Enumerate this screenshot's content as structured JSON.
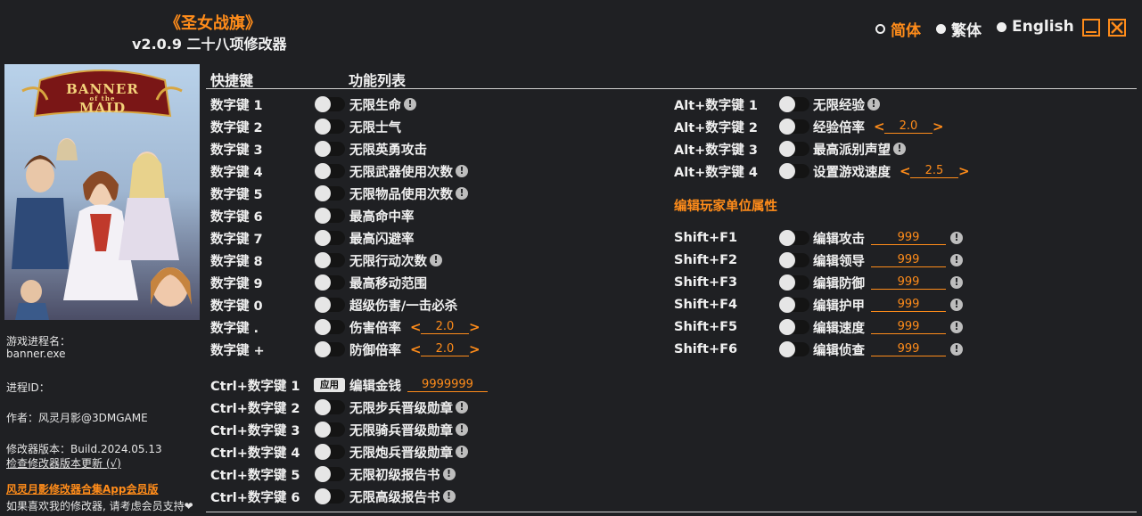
{
  "title": {
    "game": "《圣女战旗》",
    "trainer": "v2.0.9 二十八项修改器"
  },
  "languages": [
    {
      "label": "简体",
      "active": true
    },
    {
      "label": "繁体",
      "active": false
    },
    {
      "label": "English",
      "active": false
    }
  ],
  "banner": {
    "logo_line1": "BANNER",
    "logo_of": "of the",
    "logo_line2": "MAID"
  },
  "sidebar": {
    "process_name_label": "游戏进程名：",
    "process_name": "banner.exe",
    "process_id_label": "进程ID：",
    "author": "作者：风灵月影@3DMGAME",
    "version": "修改器版本：Build.2024.05.13",
    "check_update": "检查修改器版本更新 (√)",
    "app_link": "风灵月影修改器合集App会员版",
    "support": "如果喜欢我的修改器, 请考虑会员支持❤"
  },
  "headers": {
    "hotkey": "快捷键",
    "features": "功能列表"
  },
  "info_glyph": "!",
  "left_rows": [
    {
      "key": "数字键 1",
      "label": "无限生命",
      "info": true
    },
    {
      "key": "数字键 2",
      "label": "无限士气",
      "info": false
    },
    {
      "key": "数字键 3",
      "label": "无限英勇攻击",
      "info": false
    },
    {
      "key": "数字键 4",
      "label": "无限武器使用次数",
      "info": true
    },
    {
      "key": "数字键 5",
      "label": "无限物品使用次数",
      "info": true
    },
    {
      "key": "数字键 6",
      "label": "最高命中率",
      "info": false
    },
    {
      "key": "数字键 7",
      "label": "最高闪避率",
      "info": false
    },
    {
      "key": "数字键 8",
      "label": "无限行动次数",
      "info": true
    },
    {
      "key": "数字键 9",
      "label": "最高移动范围",
      "info": false
    },
    {
      "key": "数字键 0",
      "label": "超级伤害/一击必杀",
      "info": false
    },
    {
      "key": "数字键 .",
      "label": "伤害倍率",
      "value": "2.0"
    },
    {
      "key": "数字键 +",
      "label": "防御倍率",
      "value": "2.0"
    }
  ],
  "arrows": {
    "left": "<",
    "right": ">"
  },
  "ctrl_rows": [
    {
      "key": "Ctrl+数字键 1",
      "label": "编辑金钱",
      "apply": "应用",
      "value": "9999999"
    },
    {
      "key": "Ctrl+数字键 2",
      "label": "无限步兵晋级勋章",
      "info": true
    },
    {
      "key": "Ctrl+数字键 3",
      "label": "无限骑兵晋级勋章",
      "info": true
    },
    {
      "key": "Ctrl+数字键 4",
      "label": "无限炮兵晋级勋章",
      "info": true
    },
    {
      "key": "Ctrl+数字键 5",
      "label": "无限初级报告书",
      "info": true
    },
    {
      "key": "Ctrl+数字键 6",
      "label": "无限高级报告书",
      "info": true
    }
  ],
  "alt_rows": [
    {
      "key": "Alt+数字键 1",
      "label": "无限经验",
      "info": true
    },
    {
      "key": "Alt+数字键 2",
      "label": "经验倍率",
      "value": "2.0"
    },
    {
      "key": "Alt+数字键 3",
      "label": "最高派别声望",
      "info": true
    },
    {
      "key": "Alt+数字键 4",
      "label": "设置游戏速度",
      "value": "2.5"
    }
  ],
  "section_title": "编辑玩家单位属性",
  "shift_rows": [
    {
      "key": "Shift+F1",
      "label": "编辑攻击",
      "value": "999"
    },
    {
      "key": "Shift+F2",
      "label": "编辑领导",
      "value": "999"
    },
    {
      "key": "Shift+F3",
      "label": "编辑防御",
      "value": "999"
    },
    {
      "key": "Shift+F4",
      "label": "编辑护甲",
      "value": "999"
    },
    {
      "key": "Shift+F5",
      "label": "编辑速度",
      "value": "999"
    },
    {
      "key": "Shift+F6",
      "label": "编辑侦查",
      "value": "999"
    }
  ],
  "colors": {
    "accent": "#ff8c1a",
    "background": "#1f2023",
    "text": "#f0f0f0"
  }
}
